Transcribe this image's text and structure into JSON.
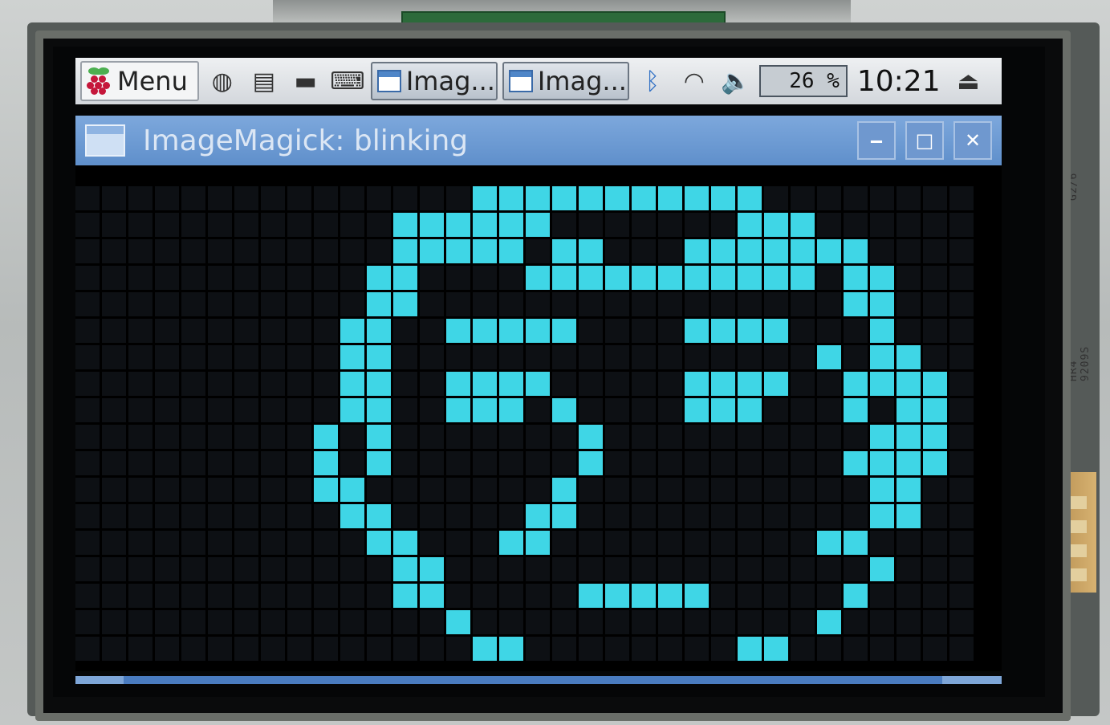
{
  "taskbar": {
    "menu_label": "Menu",
    "launchers": [
      {
        "icon": "web-browser-icon",
        "glyph": "◍"
      },
      {
        "icon": "file-manager-icon",
        "glyph": "▤"
      },
      {
        "icon": "terminal-icon",
        "glyph": "▬"
      },
      {
        "icon": "keyboard-icon",
        "glyph": "⌨"
      }
    ],
    "tasks": [
      {
        "label": "Imag..."
      },
      {
        "label": "Imag..."
      }
    ],
    "tray": {
      "bluetooth_glyph": "ᛒ",
      "wifi_glyph": "◠",
      "volume_glyph": "🔈",
      "cpu_label": "26 %",
      "clock": "10:21",
      "eject_glyph": "⏏"
    }
  },
  "window": {
    "title": "ImageMagick: blinking",
    "minimize_glyph": "‒",
    "maximize_glyph": "□",
    "close_glyph": "✕"
  },
  "device": {
    "pcb_label_1": "G2/6",
    "pcb_label_2": "HR4  9209S"
  },
  "image": {
    "pixel_color": "#3fd6e6",
    "rows": [
      "...................................",
      "...................................",
      "...............###########.........",
      "............######.......###.......",
      "............#####.##...#######.....",
      "...........##....###########.##....",
      "...........##................##....",
      "..........##..#####....####...#....",
      "..........##................#.##...",
      "..........##..####.....####..####..",
      "..........##..###.#....###...#.##..",
      ".........#.#.......#..........###..",
      ".........#.#.......#.........####..",
      ".........##.......#...........##...",
      "..........##.....##...........##...",
      "...........##...##..........##.....",
      "............##................#....",
      "............##.....#####.....#.....",
      "..............#.............#......",
      "...............##........##........",
      ".................######............"
    ]
  }
}
